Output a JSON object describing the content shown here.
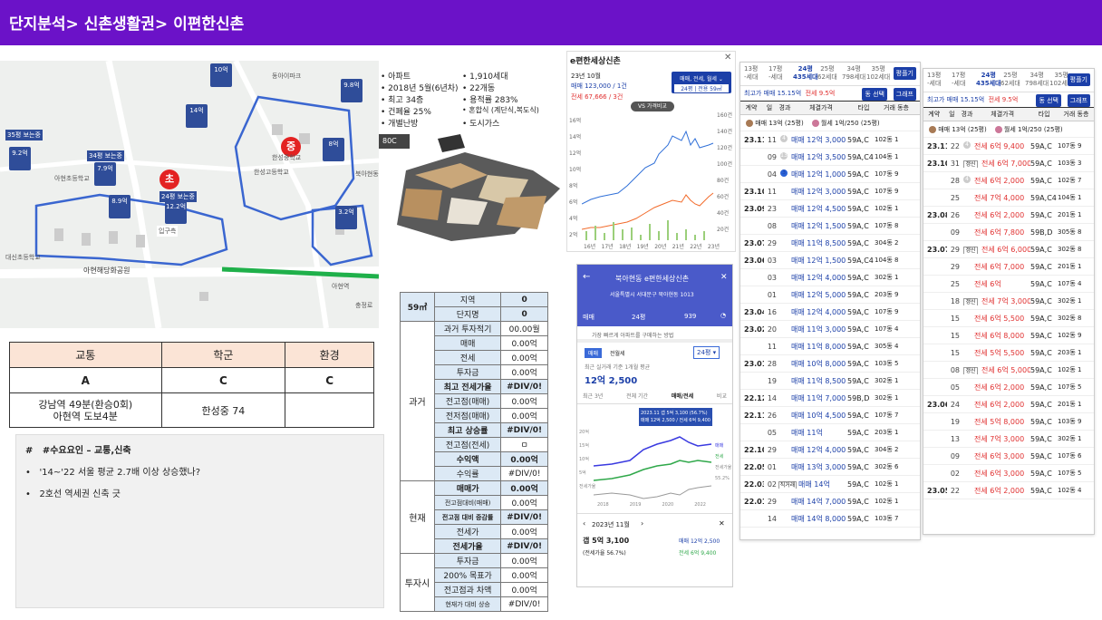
{
  "header": {
    "title": "단지분석> 신촌생활권> 이편한신촌"
  },
  "map": {
    "bubble_elementary": "초",
    "bubble_middle": "중",
    "pins": [
      "10억",
      "9.8억",
      "14억",
      "9.2억",
      "7.9억",
      "8.9억",
      "12.2억",
      "8억",
      "3.2억",
      "35평 보는중",
      "34평 보는중",
      "24평 보는중"
    ],
    "labels": [
      "아현해당화공원",
      "한성고등학교",
      "한성중학교",
      "북아현동",
      "입구측",
      "아현역",
      "충정로",
      "대신초등학교",
      "아현초등학교",
      "동아이파크"
    ],
    "colors": {
      "red": "#e32222",
      "pin": "#2f4d99",
      "line": "#1fb04a",
      "outline": "#3a66d0"
    }
  },
  "info": {
    "left": [
      "아파트",
      "2018년 5월(6년차)",
      "최고 34층",
      "건폐율 25%",
      "개별난방"
    ],
    "right": [
      "1,910세대",
      "22개동",
      "용적률 283%",
      "혼합식 (계단식,복도식)",
      "도시가스"
    ]
  },
  "plan": {
    "label": "80C"
  },
  "price_chart": {
    "title": "e편한세상신촌",
    "close": "✕",
    "period": "23년 10월",
    "sale_line": "매매 123,000 / 1건",
    "jeonse_line": "전세 67,666 / 3건",
    "filter_label": "매매, 전세, 월세 ⌄",
    "filter_sub": "24평 | 전용 59㎡",
    "vs_label": "VS 가격비교",
    "y_left": [
      "16억",
      "14억",
      "12억",
      "10억",
      "8억",
      "6억",
      "4억",
      "2억"
    ],
    "y_right": [
      "160건",
      "140건",
      "120건",
      "100건",
      "80건",
      "60건",
      "40건",
      "20건"
    ],
    "x_labels": [
      "16년",
      "17년",
      "18년",
      "19년",
      "20년",
      "21년",
      "22년",
      "23년"
    ]
  },
  "mobile": {
    "title": "북아현동 e편한세상신촌",
    "address": "서울특별시 서대문구 북아현동 1013",
    "deal_type": "매매",
    "size": "24평",
    "comments": "939",
    "banner": "가장 빠르게 아파트를 구매하는 방법",
    "tab_sale": "매매",
    "tab_jeonse": "전월세",
    "size_select": "24평 ▾",
    "recent_label": "최근 실거래 기준 1개월 평균",
    "recent_price": "12억 2,500",
    "sub_tabs": [
      "최근 3년",
      "전체 기간",
      "매매/전세",
      "비교"
    ],
    "tooltip1": "2023.11 갭 5억 3,100 (56.7%)",
    "tooltip2": "매매 12억 2,500 / 전세 6억 9,400",
    "y_labels": [
      "20억",
      "15억",
      "10억",
      "5억",
      "전세가율"
    ],
    "x_labels": [
      "2018",
      "2019",
      "2020",
      "2022"
    ],
    "legend": [
      "매매",
      "전세",
      "전세가율"
    ],
    "pct_label": "55.2%",
    "month": "2023년 11월",
    "gap": "갭 5억 3,100",
    "gap_rate": "(전세가율 56.7%)",
    "sale_price": "매매 12억 2,500",
    "jeonse_price": "전세 6억 9,400"
  },
  "scores": {
    "headers": [
      "교통",
      "학군",
      "환경"
    ],
    "grades": [
      "A",
      "C",
      "C"
    ],
    "details": [
      "강남역 49분(환승0회)\n아현역 도보4분",
      "한성중 74",
      ""
    ]
  },
  "notes": {
    "title": "#수요요인 – 교통,신축",
    "title_mark": "#",
    "bullets": [
      "'14~'22 서울 평균 2.7배 이상 상승했나?",
      "2호선 역세권 신축 긋"
    ]
  },
  "invest": {
    "unit_label": "59㎡",
    "top": [
      [
        "지역",
        "0"
      ],
      [
        "단지명",
        "0"
      ]
    ],
    "past_label": "과거",
    "past": [
      [
        "과거 투자적기",
        "00.00월"
      ],
      [
        "매매",
        "0.00억"
      ],
      [
        "전세",
        "0.00억"
      ],
      [
        "투자금",
        "0.00억"
      ],
      [
        "최고 전세가율",
        "#DIV/0!"
      ],
      [
        "전고점(매매)",
        "0.00억"
      ],
      [
        "전저점(매매)",
        "0.00억"
      ],
      [
        "최고 상승률",
        "#DIV/0!"
      ],
      [
        "전고점(전세)",
        "ㅁ"
      ],
      [
        "수익액",
        "0.00억"
      ],
      [
        "수익률",
        "#DIV/0!"
      ]
    ],
    "now_label": "현재",
    "now": [
      [
        "매매가",
        "0.00억"
      ],
      [
        "전고점대비(매매)",
        "0.00억"
      ],
      [
        "전고점 대비 증감률",
        "#DIV/0!"
      ],
      [
        "전세가",
        "0.00억"
      ],
      [
        "전세가율",
        "#DIV/0!"
      ]
    ],
    "invest_label": "투자시",
    "invest": [
      [
        "투자금",
        "0.00억"
      ],
      [
        "200% 목표가",
        "0.00억"
      ],
      [
        "전고점과 차액",
        "0.00억"
      ],
      [
        "현재가 대비 상승",
        "#DIV/0!"
      ]
    ]
  },
  "deal1": {
    "tabs": [
      [
        "13평",
        "-세대"
      ],
      [
        "17평",
        "-세대"
      ],
      [
        "24평",
        "435세대"
      ],
      [
        "25평",
        "62세대"
      ],
      [
        "34평",
        "798세대"
      ],
      [
        "35평",
        "102세대"
      ]
    ],
    "button": "평플기",
    "meta_left": "최고가 매매 15.15억",
    "meta_right": "전세 9.5억",
    "btn1": "동 선택",
    "btn2": "그래프",
    "headers": [
      "계약",
      "일",
      "경과",
      "체결가격",
      "타입",
      "거래 동층"
    ],
    "person1": "매매 13억 (25평)",
    "person2": "월세 1억/250 (25평)",
    "rows": [
      [
        "23.11",
        "11",
        "4",
        "매매 12억 3,000",
        "59A,C",
        "102동 15층"
      ],
      [
        "",
        "09",
        "13",
        "매매 12억 3,500",
        "59A,C4",
        "104동 19층"
      ],
      [
        "",
        "04",
        "3",
        "매매 12억 1,000",
        "59A,C",
        "107동 9층"
      ],
      [
        "23.10",
        "11",
        "",
        "매매 12억 3,000",
        "59A,C",
        "107동 9층"
      ],
      [
        "23.09",
        "23",
        "",
        "매매 12억 4,500",
        "59A,C",
        "102동 10층"
      ],
      [
        "",
        "08",
        "",
        "매매 12억 1,500",
        "59A,C",
        "107동 8층"
      ],
      [
        "23.07",
        "29",
        "",
        "매매 11억 8,500",
        "59A,C",
        "304동 2층"
      ],
      [
        "23.06",
        "03",
        "",
        "매매 12억 1,500",
        "59A,C4",
        "104동 8층"
      ],
      [
        "",
        "03",
        "",
        "매매 12억 4,000",
        "59A,C",
        "302동 11층"
      ],
      [
        "",
        "01",
        "",
        "매매 12억 5,000",
        "59A,C",
        "203동 9층"
      ],
      [
        "23.04",
        "16",
        "",
        "매매 12억 4,000",
        "59A,C",
        "107동 9층"
      ],
      [
        "23.02",
        "20",
        "",
        "매매 11억 3,000",
        "59A,C",
        "107동 4층"
      ],
      [
        "",
        "11",
        "",
        "매매 11억 8,000",
        "59A,C",
        "305동 4층"
      ],
      [
        "23.01",
        "28",
        "",
        "매매 10억 8,000",
        "59A,C",
        "103동 5층"
      ],
      [
        "",
        "19",
        "",
        "매매 11억 8,500",
        "59A,C",
        "302동 13층"
      ],
      [
        "22.12",
        "14",
        "",
        "매매 11억 7,000",
        "59B,D",
        "302동 16층"
      ],
      [
        "22.11",
        "26",
        "",
        "매매 10억 4,500",
        "59A,C",
        "107동 7층"
      ],
      [
        "",
        "05",
        "",
        "매매 11억",
        "59A,C",
        "203동 17층"
      ],
      [
        "22.10",
        "29",
        "",
        "매매 12억 4,000",
        "59A,C",
        "304동 2층"
      ],
      [
        "22.05",
        "01",
        "",
        "매매 13억 3,000",
        "59A,C",
        "302동 6층"
      ],
      [
        "22.03",
        "02",
        "직거래",
        "매매 14억",
        "59A,C",
        "102동 13층"
      ],
      [
        "22.01",
        "29",
        "",
        "매매 14억 7,000",
        "59A,C",
        "102동 17층"
      ],
      [
        "",
        "14",
        "",
        "매매 14억 8,000",
        "59A,C",
        "103동 7층"
      ]
    ]
  },
  "deal2": {
    "tabs": [
      [
        "13평",
        "-세대"
      ],
      [
        "17평",
        "-세대"
      ],
      [
        "24평",
        "435세대"
      ],
      [
        "25평",
        "62세대"
      ],
      [
        "34평",
        "798세대"
      ],
      [
        "35평",
        "102세대"
      ]
    ],
    "button": "평플기",
    "meta_left": "최고가 매매 15.15억",
    "meta_right": "전세 9.5억",
    "btn1": "동 선택",
    "btn2": "그래프",
    "headers": [
      "계약",
      "일",
      "경과",
      "체결가격",
      "타입",
      "거래 동층"
    ],
    "person1": "매매 13억 (25평)",
    "person2": "월세 1억/250 (25평)",
    "rows": [
      [
        "23.11",
        "22",
        "4",
        "전세 6억 9,400",
        "59A,C",
        "107동 9층"
      ],
      [
        "23.10",
        "31",
        "갱신",
        "전세 6억 7,000",
        "59A,C",
        "103동 3층"
      ],
      [
        "",
        "28",
        "4",
        "전세 6억 2,000",
        "59A,C",
        "102동 7층"
      ],
      [
        "",
        "25",
        "",
        "전세 7억 4,000",
        "59A,C4",
        "104동 13층"
      ],
      [
        "23.08",
        "26",
        "",
        "전세 6억 2,000",
        "59A,C",
        "201동 16층"
      ],
      [
        "",
        "09",
        "",
        "전세 6억 7,800",
        "59B,D",
        "305동 8층"
      ],
      [
        "23.07",
        "29",
        "갱신",
        "전세 6억 6,000",
        "59A,C",
        "302동 8층"
      ],
      [
        "",
        "29",
        "",
        "전세 6억 7,000",
        "59A,C",
        "201동 17층"
      ],
      [
        "",
        "25",
        "",
        "전세 6억",
        "59A,C",
        "107동 4층"
      ],
      [
        "",
        "18",
        "갱신",
        "전세 7억 3,000",
        "59A,C",
        "302동 11층"
      ],
      [
        "",
        "15",
        "",
        "전세 6억 5,500",
        "59A,C",
        "302동 8층"
      ],
      [
        "",
        "15",
        "",
        "전세 6억 8,000",
        "59A,C",
        "102동 9층"
      ],
      [
        "",
        "15",
        "",
        "전세 5억 5,500",
        "59A,C",
        "203동 13층"
      ],
      [
        "",
        "08",
        "갱신",
        "전세 6억 5,000",
        "59A,C",
        "102동 15층"
      ],
      [
        "",
        "05",
        "",
        "전세 6억 2,000",
        "59A,C",
        "107동 5층"
      ],
      [
        "23.06",
        "24",
        "",
        "전세 6억 2,000",
        "59A,C",
        "201동 17층"
      ],
      [
        "",
        "19",
        "",
        "전세 5억 8,000",
        "59A,C",
        "103동 9층"
      ],
      [
        "",
        "13",
        "",
        "전세 7억 3,000",
        "59A,C",
        "302동 16층"
      ],
      [
        "",
        "09",
        "",
        "전세 6억 3,000",
        "59A,C",
        "107동 6층"
      ],
      [
        "",
        "02",
        "",
        "전세 6억 3,000",
        "59A,C",
        "107동 5층"
      ],
      [
        "23.05",
        "22",
        "",
        "전세 6억 2,000",
        "59A,C",
        "102동 4층"
      ]
    ]
  }
}
